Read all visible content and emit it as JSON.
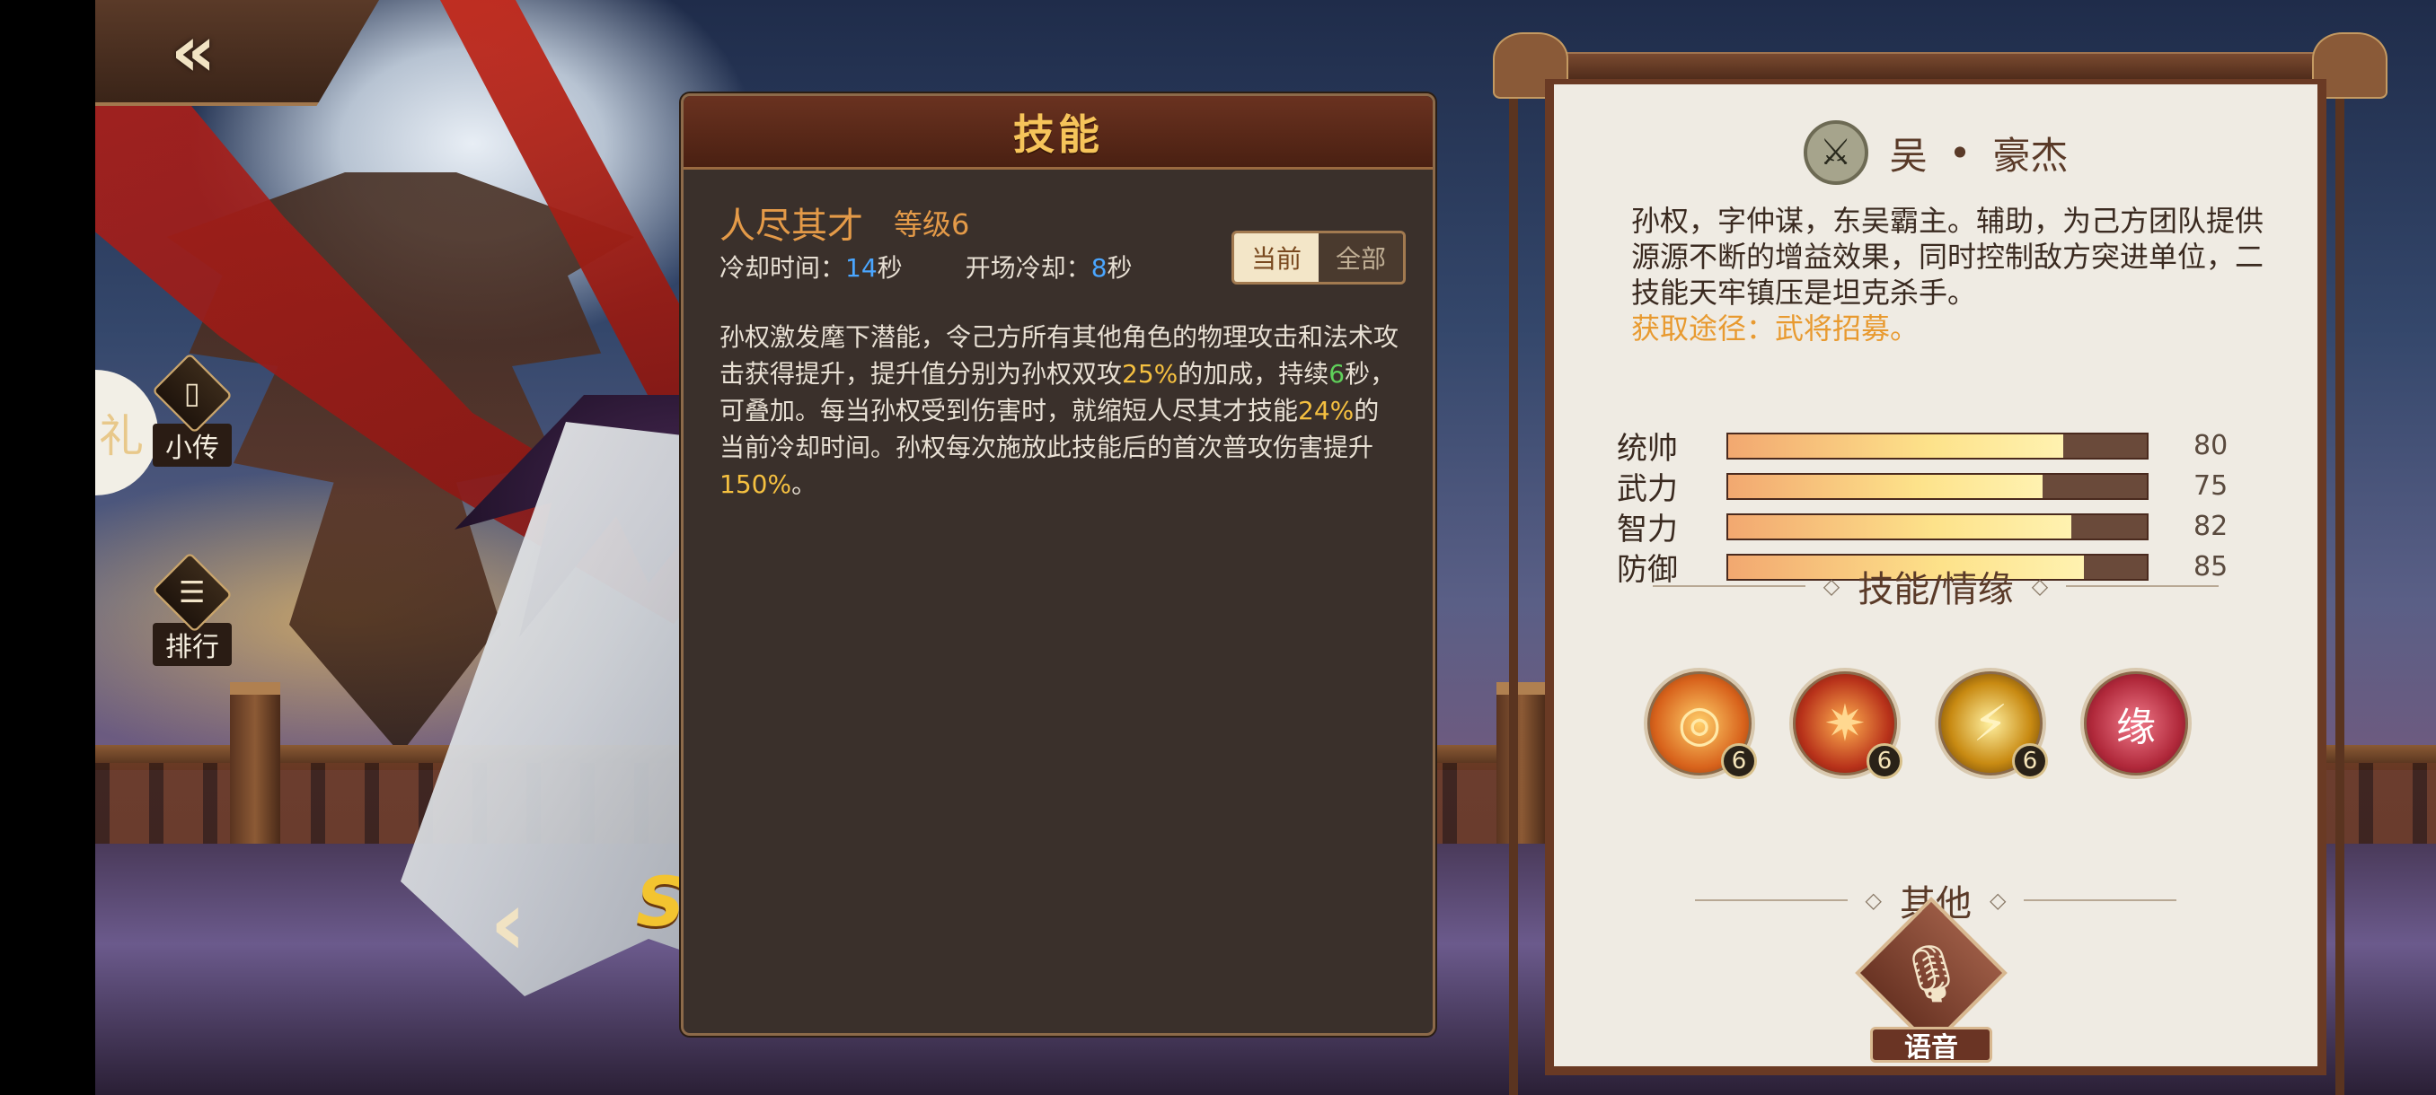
{
  "left": {
    "back_icon": "double-chevron-left-icon",
    "side_tab_char": "礼",
    "side_buttons": [
      {
        "label": "小传",
        "icon": "scroll-book-icon"
      },
      {
        "label": "排行",
        "icon": "ranking-scroll-icon"
      }
    ],
    "rank_badge": "SS"
  },
  "skill_panel": {
    "title": "技能",
    "skill_name": "人尽其才",
    "skill_level": "等级6",
    "cooldown_label": "冷却时间：",
    "cooldown_value": "14",
    "cooldown_unit": "秒",
    "opening_cd_label": "开场冷却：",
    "opening_cd_value": "8",
    "opening_cd_unit": "秒",
    "toggle": {
      "current": "当前",
      "all": "全部"
    },
    "desc": {
      "p1": "孙权激发麾下潜能，令己方所有其他角色的物理攻击和法术攻击获得提升，提升值分别为孙权双攻",
      "v1": "25%",
      "p2": "的加成，持续",
      "v2": "6",
      "p3": "秒，可叠加。每当孙权受到伤害时，就缩短人尽其才技能",
      "v3": "24%",
      "p4": "的当前冷却时间。孙权每次施放此技能后的首次普攻伤害提升",
      "v4": "150%",
      "p5": "。"
    }
  },
  "info": {
    "faction_icon": "crossed-swords-icon",
    "faction": "吴",
    "dot": "•",
    "type": "豪杰",
    "bio": "孙权，字仲谋，东吴霸主。辅助，为己方团队提供源源不断的增益效果，同时控制敌方突进单位，二技能天牢镇压是坦克杀手。",
    "obtain": "获取途径：武将招募。",
    "stats": [
      {
        "name": "统帅",
        "value": "80",
        "fill": 0.8
      },
      {
        "name": "武力",
        "value": "75",
        "fill": 0.75
      },
      {
        "name": "智力",
        "value": "82",
        "fill": 0.82
      },
      {
        "name": "防御",
        "value": "85",
        "fill": 0.85
      }
    ],
    "section_skills": "技能/情缘",
    "skill_icons": [
      {
        "name": "whirlwind-skill-icon",
        "glyph": "◎",
        "level": "6",
        "bg": "#d8631c"
      },
      {
        "name": "burst-skill-icon",
        "glyph": "✷",
        "level": "6",
        "bg": "#b8321a"
      },
      {
        "name": "strike-skill-icon",
        "glyph": "⚡",
        "level": "6",
        "bg": "#c88a12"
      },
      {
        "name": "bond-icon",
        "glyph": "缘",
        "level": "",
        "bg": "#b0283a"
      }
    ],
    "section_other": "其他",
    "voice_label": "语音",
    "voice_icon": "microphone-icon"
  }
}
